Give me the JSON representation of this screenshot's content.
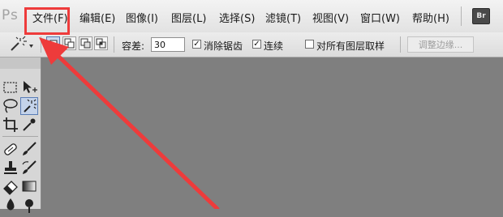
{
  "app": {
    "logo": "Ps"
  },
  "menu": {
    "items": [
      "文件(F)",
      "编辑(E)",
      "图像(I)",
      "图层(L)",
      "选择(S)",
      "滤镜(T)",
      "视图(V)",
      "窗口(W)",
      "帮助(H)"
    ],
    "bridge_badge": "Br"
  },
  "options": {
    "tolerance_label": "容差:",
    "tolerance_value": "30",
    "antialias_label": "消除锯齿",
    "antialias_checked": true,
    "contiguous_label": "连续",
    "contiguous_checked": true,
    "sample_all_layers_label": "对所有图层取样",
    "sample_all_layers_checked": false,
    "refine_edge_label": "调整边缘..."
  },
  "tools": {
    "active": "magic-wand-icon",
    "icons": [
      "rectangular-marquee-icon",
      "move-icon",
      "lasso-icon",
      "magic-wand-icon",
      "crop-icon",
      "eyedropper-icon",
      "healing-brush-icon",
      "brush-icon",
      "clone-stamp-icon",
      "history-brush-icon",
      "eraser-icon",
      "gradient-icon"
    ]
  },
  "annotation": {
    "highlight_color": "#ee3b3b",
    "target": "menu-file"
  },
  "colors": {
    "workspace": "#7f7f7f",
    "menubar": "#e9e9e9",
    "annotation": "#ee3b3b"
  }
}
